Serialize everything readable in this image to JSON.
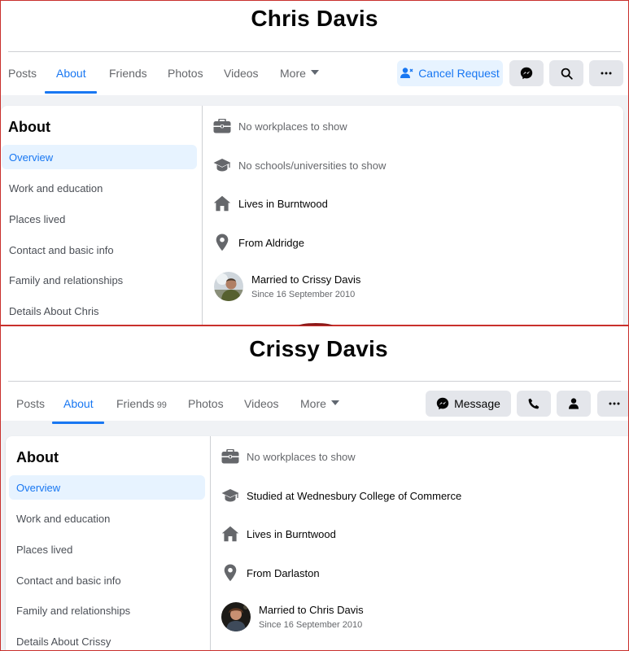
{
  "profiles": [
    {
      "name": "Chris Davis",
      "tabs": {
        "posts": "Posts",
        "about": "About",
        "friends": "Friends",
        "photos": "Photos",
        "videos": "Videos",
        "more": "More"
      },
      "actions": {
        "cancel_request": "Cancel Request"
      },
      "sidebar": {
        "title": "About",
        "items": [
          "Overview",
          "Work and education",
          "Places lived",
          "Contact and basic info",
          "Family and relationships",
          "Details About Chris"
        ]
      },
      "overview": {
        "work": "No workplaces to show",
        "education": "No schools/universities to show",
        "lives": "Lives in Burntwood",
        "from": "From Aldridge",
        "married": "Married to Crissy Davis",
        "since": "Since 16 September 2010"
      }
    },
    {
      "name": "Crissy Davis",
      "tabs": {
        "posts": "Posts",
        "about": "About",
        "friends": "Friends",
        "friends_count": "99",
        "photos": "Photos",
        "videos": "Videos",
        "more": "More"
      },
      "actions": {
        "message": "Message"
      },
      "sidebar": {
        "title": "About",
        "items": [
          "Overview",
          "Work and education",
          "Places lived",
          "Contact and basic info",
          "Family and relationships",
          "Details About Crissy"
        ]
      },
      "overview": {
        "work": "No workplaces to show",
        "education": "Studied at Wednesbury College of Commerce",
        "lives": "Lives in Burntwood",
        "from": "From Darlaston",
        "married": "Married to Chris Davis",
        "since": "Since 16 September 2010"
      }
    }
  ],
  "colors": {
    "accent": "#1877f2",
    "accent_bg": "#e7f3ff",
    "button_grey": "#e4e6eb",
    "panel_border": "#c9302c"
  }
}
